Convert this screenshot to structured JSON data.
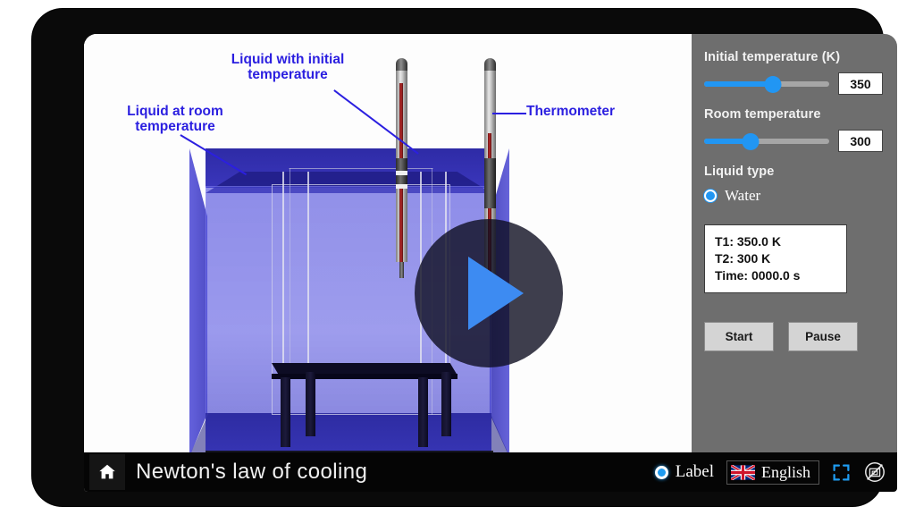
{
  "app": {
    "title": "Newton's law of cooling"
  },
  "annotations": [
    {
      "name": "liquid-initial",
      "text": "Liquid with initial\ntemperature"
    },
    {
      "name": "liquid-room",
      "text": "Liquid at room\ntemperature"
    },
    {
      "name": "thermometer",
      "text": "Thermometer"
    }
  ],
  "controls": {
    "initial_temp": {
      "label": "Initial temperature (K)",
      "value": "350",
      "fill_percent": 55
    },
    "room_temp": {
      "label": "Room temperature",
      "value": "300",
      "fill_percent": 37
    },
    "liquid_type": {
      "label": "Liquid type",
      "options": [
        "Water"
      ],
      "selected": "Water"
    },
    "buttons": {
      "start": "Start",
      "pause": "Pause"
    }
  },
  "readout": {
    "t1": "T1: 350.0 K",
    "t2": "T2: 300 K",
    "time": "Time: 0000.0 s"
  },
  "footer": {
    "home_icon": "home-icon",
    "title": "Newton's law of cooling",
    "label_toggle": "Label",
    "language": "English",
    "language_flag": "uk-flag-icon",
    "fullscreen_icon": "fullscreen-icon",
    "disabled_icon": "no-annotation-icon"
  },
  "overlay": {
    "play_icon": "play-icon"
  },
  "colors": {
    "accent_blue": "#2196f3",
    "annotation_blue": "#2b1fe0",
    "panel_gray": "#6e6e6e",
    "footer_black": "#050505",
    "liquid_blue": "#5350d8"
  }
}
